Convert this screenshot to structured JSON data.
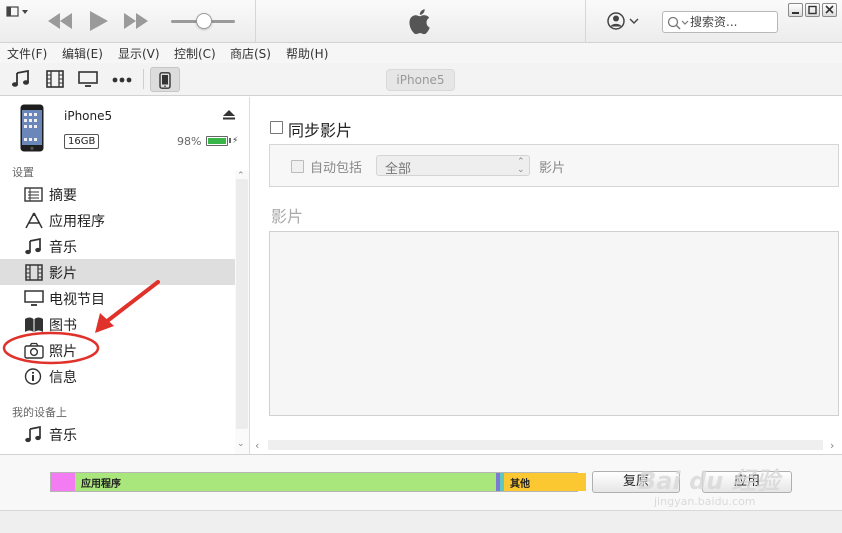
{
  "window": {
    "title_logo": "apple-logo"
  },
  "search": {
    "placeholder": "搜索资..."
  },
  "menubar": {
    "items": [
      "文件(F)",
      "编辑(E)",
      "显示(V)",
      "控制(C)",
      "商店(S)",
      "帮助(H)"
    ]
  },
  "mediabar": {
    "icons": [
      "music-note-icon",
      "film-icon",
      "tv-icon",
      "more-icon",
      "iphone-icon"
    ],
    "device_pill": "iPhone5"
  },
  "device": {
    "name": "iPhone5",
    "capacity": "16GB",
    "battery_text": "98%",
    "battery_level": 0.98
  },
  "sidebar": {
    "settings_title": "设置",
    "items": [
      {
        "label": "摘要",
        "icon": "summary-icon"
      },
      {
        "label": "应用程序",
        "icon": "apps-icon"
      },
      {
        "label": "音乐",
        "icon": "music-icon"
      },
      {
        "label": "影片",
        "icon": "film-icon",
        "selected": true
      },
      {
        "label": "电视节目",
        "icon": "tv-icon"
      },
      {
        "label": "图书",
        "icon": "book-icon"
      },
      {
        "label": "照片",
        "icon": "camera-icon"
      },
      {
        "label": "信息",
        "icon": "info-icon"
      }
    ],
    "ondevice_title": "我的设备上",
    "ondevice_items": [
      {
        "label": "音乐",
        "icon": "music-icon"
      }
    ]
  },
  "main": {
    "sync_label": "同步影片",
    "sync_checked": false,
    "include_label": "自动包括",
    "include_value": "全部",
    "include_suffix": "影片",
    "movies_title": "影片"
  },
  "storage": {
    "segments": [
      {
        "label": "",
        "color": "#f47cf2",
        "fraction": 0.045
      },
      {
        "label": "应用程序",
        "color": "#a9e67b",
        "fraction": 0.8
      },
      {
        "label": "",
        "color": "#7a7bd1",
        "fraction": 0.008
      },
      {
        "label": "",
        "color": "#5fc7c0",
        "fraction": 0.008
      },
      {
        "label": "其他",
        "color": "#fcc832",
        "fraction": 0.155
      }
    ]
  },
  "buttons": {
    "restore": "复原",
    "apply": "应用"
  },
  "watermark": {
    "text": "Bai du 经验",
    "url": "jingyan.baidu.com"
  },
  "colors": {
    "accent_red": "#e0322a",
    "selected_row": "#dedede",
    "battery_green": "#39b54a"
  }
}
